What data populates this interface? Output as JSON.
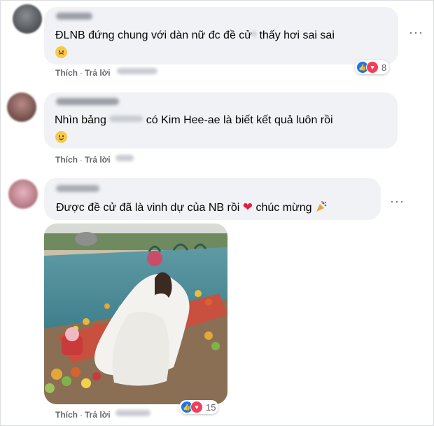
{
  "actions": {
    "like": "Thích",
    "reply": "Trả lời",
    "separator": "·"
  },
  "more_icon": "more-options-icon",
  "comments": [
    {
      "text": "ĐLNB đứng chung với dàn nữ đc đề cử",
      "text_after": "thấy hơi sai sai",
      "emoji": "downcast-face-icon",
      "reaction_count": "8"
    },
    {
      "text": "Nhìn bảng",
      "text_after": "có Kim Hee-ae là biết kết quả luôn rồi",
      "emoji": "smiling-face-icon"
    },
    {
      "text": "Được đề cử đã là vinh dự của NB rồi",
      "heart": "❤",
      "text_after": "chúc mừng",
      "emoji": "party-popper-icon",
      "reaction_count": "15"
    }
  ],
  "colors": {
    "bubble": "#f0f2f5",
    "meta": "#65676b",
    "like": "#1877f2",
    "love": "#f33e58"
  }
}
